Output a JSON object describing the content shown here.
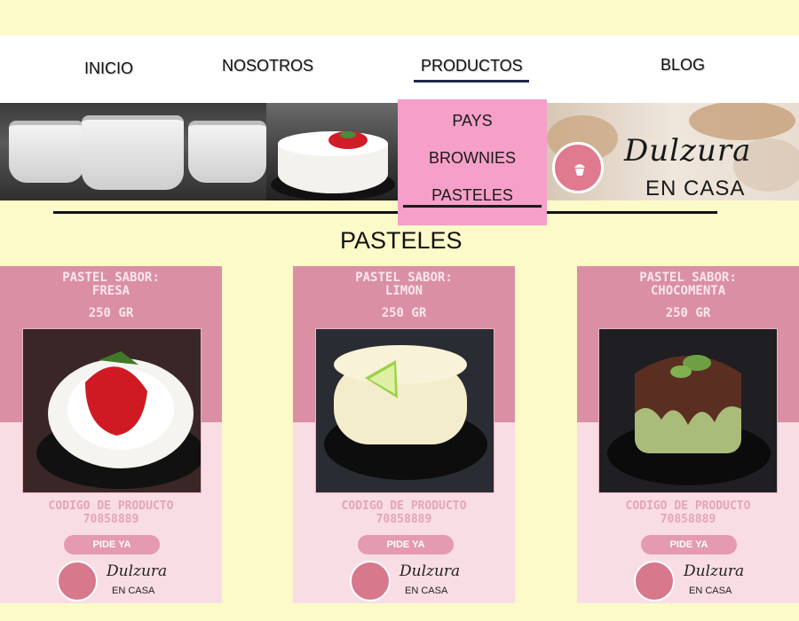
{
  "nav": {
    "items": [
      {
        "label": "INICIO"
      },
      {
        "label": "NOSOTROS"
      },
      {
        "label": "PRODUCTOS"
      },
      {
        "label": "BLOG"
      }
    ],
    "active": "PRODUCTOS"
  },
  "dropdown": {
    "items": [
      {
        "label": "PAYS"
      },
      {
        "label": "BROWNIES"
      },
      {
        "label": "PASTELES"
      }
    ],
    "selected": "PASTELES"
  },
  "brand": {
    "script": "Dulzura",
    "sub": "EN CASA"
  },
  "section": {
    "title": "PASTELES"
  },
  "products": [
    {
      "name_line1": "PASTEL SABOR:",
      "name_line2": "FRESA",
      "weight": "250 GR",
      "code_label": "CODIGO DE PRODUCTO",
      "code": "70858889",
      "button": "PIDE YA"
    },
    {
      "name_line1": "PASTEL SABOR:",
      "name_line2": "LIMON",
      "weight": "250 GR",
      "code_label": "CODIGO DE PRODUCTO",
      "code": "70858889",
      "button": "PIDE YA"
    },
    {
      "name_line1": "PASTEL SABOR:",
      "name_line2": "CHOCOMENTA",
      "weight": "250 GR",
      "code_label": "CODIGO DE PRODUCTO",
      "code": "70858889",
      "button": "PIDE YA"
    }
  ],
  "card_brand": {
    "script": "Dulzura",
    "sub": "EN CASA"
  },
  "colors": {
    "background": "#fdfac9",
    "dropdown": "#f69fc8",
    "card_top": "#db8fa4",
    "card_bottom": "#f9dde4",
    "button": "#e49ab0"
  }
}
